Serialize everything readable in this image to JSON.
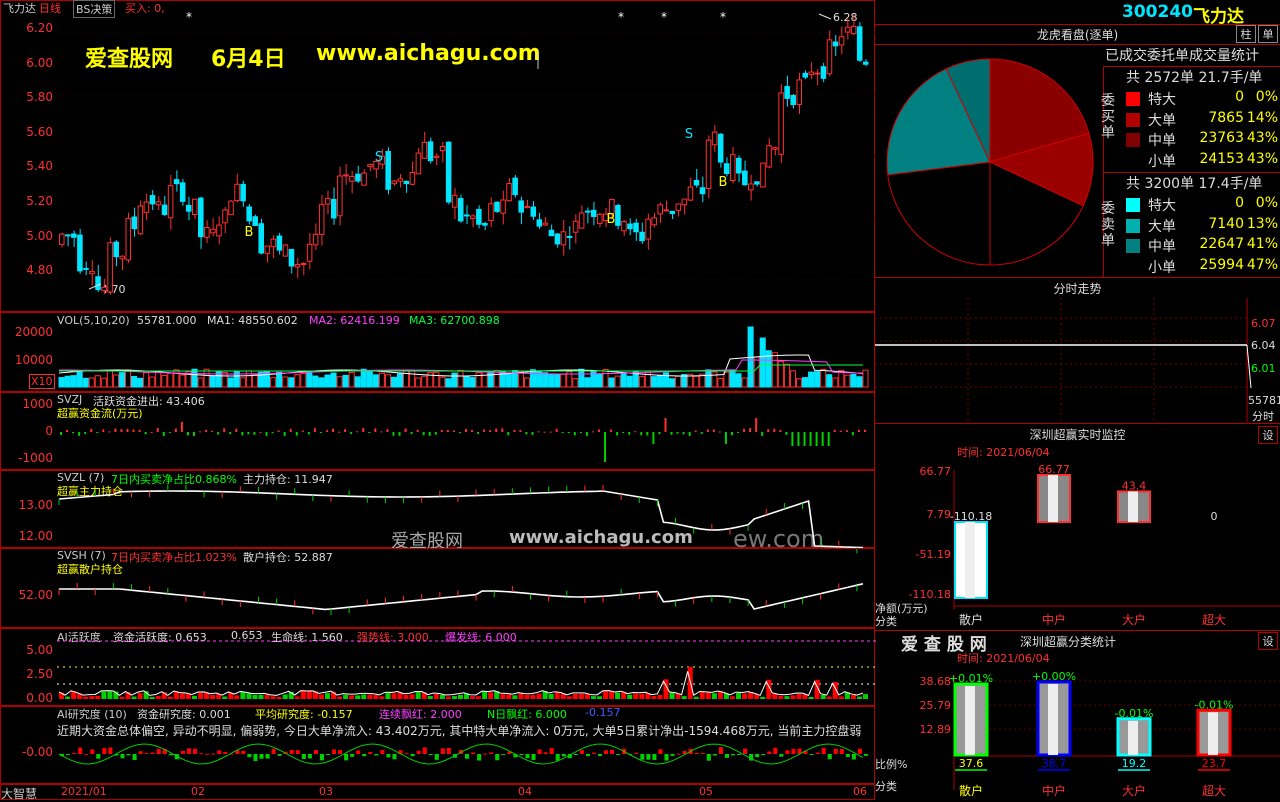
{
  "header": {
    "stock_name": "飞力达",
    "period": "日线",
    "strategy": "BS决策",
    "buy_label": "买入: 0,"
  },
  "watermark": {
    "site": "爱查股网",
    "date": "6月4日",
    "url": "www.aichagu.com",
    "mid_site": "爱查股网",
    "mid_url": "www.aichagu.com",
    "mid_tail": "ew.com"
  },
  "price_axis": [
    "6.20",
    "6.00",
    "5.80",
    "5.60",
    "5.40",
    "5.20",
    "5.00",
    "4.80"
  ],
  "price_high": "6.28",
  "price_low": "4.70",
  "signals": {
    "b": "B",
    "s": "S"
  },
  "vol": {
    "legend": "VOL(5,10,20)",
    "value": "55781.000",
    "ma1": "MA1: 48550.602",
    "ma2": "MA2: 62416.199",
    "ma3": "MA3: 62700.898",
    "axis": [
      "20000",
      "10000"
    ],
    "unit": "X10"
  },
  "svzj": {
    "title": "SVZJ",
    "line": "活跃资金进出: 43.406",
    "sub": "超赢资金流(万元)",
    "axis": [
      "1000",
      "0",
      "-1000"
    ]
  },
  "svzl": {
    "title": "SVZL (7)",
    "ratio": "7日内买卖净占比0.868%",
    "hold": "主力持仓: 11.947",
    "sub": "超赢主力持仓",
    "axis": [
      "13.00",
      "12.00"
    ]
  },
  "svsh": {
    "title": "SVSH (7)",
    "ratio": "7日内买卖净占比1.023%",
    "hold": "散户持仓: 52.887",
    "sub": "超赢散户持仓",
    "axis": [
      "52.00"
    ]
  },
  "ai_active": {
    "title": "AI活跃度",
    "a": "资金活跃度: 0.653",
    "b": "0.653",
    "c": "生命线: 1.560",
    "d": "强势线: 3.000",
    "e": "爆发线: 6.000",
    "axis": [
      "5.00",
      "2.50",
      "0.00"
    ]
  },
  "ai_research": {
    "title": "AI研究度 (10)",
    "a": "资金研究度: 0.001",
    "b": "平均研究度: -0.157",
    "c": "连续飘红: 2.000",
    "d": "N日飘红: 6.000",
    "e": "-0.157",
    "text": "近期大资金总体偏空, 异动不明显, 偏弱势, 今日大单净流入: 43.402万元, 其中特大单净流入: 0万元, 大单5日累计净出-1594.468万元, 当前主力控盘弱",
    "axis": [
      "-0.00"
    ]
  },
  "corner_label": "大智慧",
  "date_axis": [
    "2021/01",
    "02",
    "03",
    "04",
    "05",
    "06"
  ],
  "right": {
    "code": "300240",
    "name": "飞力达",
    "dragon_title": "龙虎看盘(逐单)",
    "tab_bar": "柱",
    "tab_list": "单",
    "stat_title": "已成交委托单成交量统计",
    "buy_side_label": "委买单",
    "sell_side_label": "委卖单",
    "buy_total": "共 2572单 21.7手/单",
    "sell_total": "共 3200单 17.4手/单",
    "buy_rows": [
      {
        "name": "特大",
        "qty": "0",
        "pct": "0%",
        "color": "#ff0000"
      },
      {
        "name": "大单",
        "qty": "7865",
        "pct": "14%",
        "color": "#b00000"
      },
      {
        "name": "中单",
        "qty": "23763",
        "pct": "43%",
        "color": "#800000"
      },
      {
        "name": "小单",
        "qty": "24153",
        "pct": "43%",
        "color": "#000000"
      }
    ],
    "sell_rows": [
      {
        "name": "特大",
        "qty": "0",
        "pct": "0%",
        "color": "#00ffff"
      },
      {
        "name": "大单",
        "qty": "7140",
        "pct": "13%",
        "color": "#00b0b0"
      },
      {
        "name": "中单",
        "qty": "22647",
        "pct": "41%",
        "color": "#008080"
      },
      {
        "name": "小单",
        "qty": "25994",
        "pct": "47%",
        "color": "#000000"
      }
    ],
    "intraday_title": "分时走势",
    "intraday_axis": [
      "6.07",
      "6.04",
      "6.01"
    ],
    "intraday_vol": "55781",
    "intraday_fs": "分时",
    "monitor_title": "深圳超赢实时监控",
    "monitor_setting": "设",
    "monitor_time": "时间: 2021/06/04",
    "monitor_axis": [
      "66.77",
      "7.79",
      "-51.19",
      "-110.18"
    ],
    "monitor_unit": "净额(万元)",
    "monitor_cat": "分类",
    "monitor_bars": [
      {
        "name": "散户",
        "value": "-110.18"
      },
      {
        "name": "中户",
        "value": "66.77"
      },
      {
        "name": "大户",
        "value": "43.4"
      },
      {
        "name": "超大",
        "value": "0"
      }
    ],
    "class_brand": "爱 查 股 网",
    "class_title": "深圳超赢分类统计",
    "class_setting": "设",
    "class_time": "时间: 2021/06/04",
    "class_axis": [
      "38.68",
      "25.79",
      "12.89"
    ],
    "class_ratio": "比例%",
    "class_cat": "分类",
    "class_bars": [
      {
        "name": "散户",
        "delta": "+0.01%",
        "value": "37.6"
      },
      {
        "name": "中户",
        "delta": "+0.00%",
        "value": "38.7"
      },
      {
        "name": "大户",
        "delta": "-0.01%",
        "value": "19.2"
      },
      {
        "name": "超大",
        "delta": "-0.01%",
        "value": "23.7"
      }
    ]
  },
  "colors": {
    "up": "#ff3030",
    "down": "#00e5ff",
    "grid": "#b00000",
    "yellow": "#ffff00"
  }
}
